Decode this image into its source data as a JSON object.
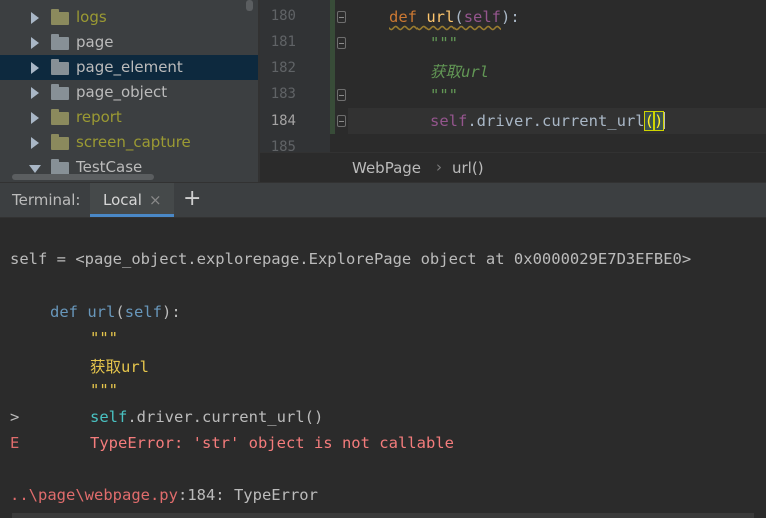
{
  "project_tree": {
    "items": [
      {
        "label": "logs",
        "style": "olive",
        "expanded": false,
        "selected": false
      },
      {
        "label": "page",
        "style": "normal",
        "expanded": false,
        "selected": false
      },
      {
        "label": "page_element",
        "style": "normal",
        "expanded": false,
        "selected": true
      },
      {
        "label": "page_object",
        "style": "normal",
        "expanded": false,
        "selected": false
      },
      {
        "label": "report",
        "style": "olive",
        "expanded": false,
        "selected": false
      },
      {
        "label": "screen_capture",
        "style": "olive",
        "expanded": false,
        "selected": false
      },
      {
        "label": "TestCase",
        "style": "normal",
        "expanded": true,
        "selected": false
      }
    ]
  },
  "editor": {
    "line_numbers": [
      "180",
      "181",
      "182",
      "183",
      "184",
      "185"
    ],
    "current_line": "184",
    "code": {
      "l180": {
        "def_kw": "def",
        "space": " ",
        "fn_name": "url",
        "open": "(",
        "self_kw": "self",
        "close": "):"
      },
      "l181": {
        "doc": "\"\"\""
      },
      "l182": {
        "doc": "获取url"
      },
      "l183": {
        "doc": "\"\"\""
      },
      "l184": {
        "self_kw": "self",
        "rest": ".driver.current_url",
        "paren_open": "(",
        "paren_close": ")"
      }
    },
    "breadcrumb": {
      "class_name": "WebPage",
      "separator": "›",
      "method_name": "url()"
    }
  },
  "terminal": {
    "title": "Terminal:",
    "tab_label": "Local",
    "tab_close": "×",
    "add_tab": "+",
    "lines": {
      "self_repr": "self = <page_object.explorepage.ExplorePage object at 0x0000029E7D3EFBE0>",
      "def_kw": "def",
      "def_name": "url",
      "def_open": "(",
      "def_self": "self",
      "def_close": "):",
      "doc_open": "\"\"\"",
      "doc_text": "获取url",
      "doc_close": "\"\"\"",
      "prompt_marker": ">",
      "call_self": "self",
      "call_rest": ".driver.current_url()",
      "error_marker": "E",
      "error_text": "TypeError: 'str' object is not callable",
      "location_path": "..\\page\\webpage.py",
      "location_suffix": ":184: TypeError"
    }
  },
  "colors": {
    "keyword": "#cc7832",
    "function": "#ffc66d",
    "self": "#94558d",
    "docstring": "#629755",
    "error": "#e06c6c",
    "selection": "#0d293e"
  }
}
